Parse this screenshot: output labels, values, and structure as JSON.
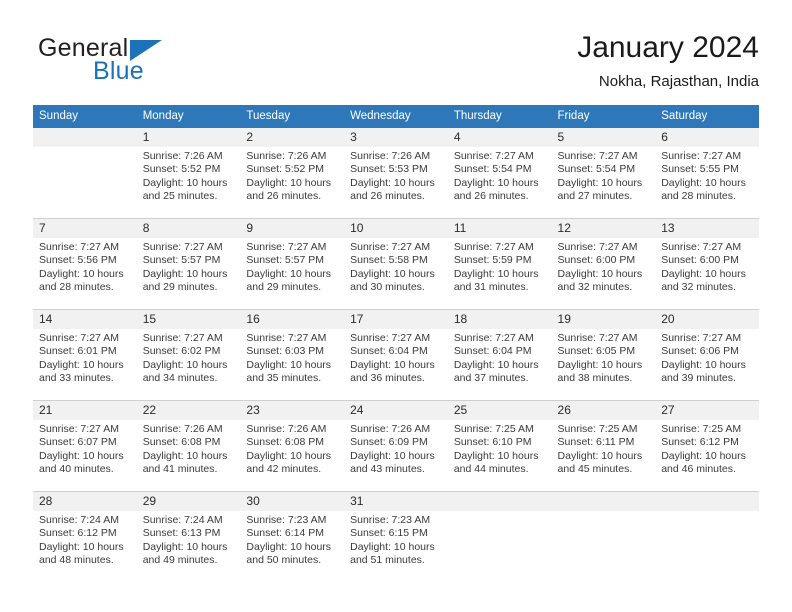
{
  "logo": {
    "word_top": "General",
    "word_bottom": "Blue",
    "brand_color": "#1b72b8"
  },
  "header": {
    "title": "January 2024",
    "subtitle": "Nokha, Rajasthan, India"
  },
  "calendar": {
    "header_color": "#2e78b9",
    "weekday_headers": [
      "Sunday",
      "Monday",
      "Tuesday",
      "Wednesday",
      "Thursday",
      "Friday",
      "Saturday"
    ],
    "weeks": [
      [
        {
          "day": "",
          "sunrise": "",
          "sunset": "",
          "daylight_line1": "",
          "daylight_line2": ""
        },
        {
          "day": "1",
          "sunrise": "Sunrise: 7:26 AM",
          "sunset": "Sunset: 5:52 PM",
          "daylight_line1": "Daylight: 10 hours",
          "daylight_line2": "and 25 minutes."
        },
        {
          "day": "2",
          "sunrise": "Sunrise: 7:26 AM",
          "sunset": "Sunset: 5:52 PM",
          "daylight_line1": "Daylight: 10 hours",
          "daylight_line2": "and 26 minutes."
        },
        {
          "day": "3",
          "sunrise": "Sunrise: 7:26 AM",
          "sunset": "Sunset: 5:53 PM",
          "daylight_line1": "Daylight: 10 hours",
          "daylight_line2": "and 26 minutes."
        },
        {
          "day": "4",
          "sunrise": "Sunrise: 7:27 AM",
          "sunset": "Sunset: 5:54 PM",
          "daylight_line1": "Daylight: 10 hours",
          "daylight_line2": "and 26 minutes."
        },
        {
          "day": "5",
          "sunrise": "Sunrise: 7:27 AM",
          "sunset": "Sunset: 5:54 PM",
          "daylight_line1": "Daylight: 10 hours",
          "daylight_line2": "and 27 minutes."
        },
        {
          "day": "6",
          "sunrise": "Sunrise: 7:27 AM",
          "sunset": "Sunset: 5:55 PM",
          "daylight_line1": "Daylight: 10 hours",
          "daylight_line2": "and 28 minutes."
        }
      ],
      [
        {
          "day": "7",
          "sunrise": "Sunrise: 7:27 AM",
          "sunset": "Sunset: 5:56 PM",
          "daylight_line1": "Daylight: 10 hours",
          "daylight_line2": "and 28 minutes."
        },
        {
          "day": "8",
          "sunrise": "Sunrise: 7:27 AM",
          "sunset": "Sunset: 5:57 PM",
          "daylight_line1": "Daylight: 10 hours",
          "daylight_line2": "and 29 minutes."
        },
        {
          "day": "9",
          "sunrise": "Sunrise: 7:27 AM",
          "sunset": "Sunset: 5:57 PM",
          "daylight_line1": "Daylight: 10 hours",
          "daylight_line2": "and 29 minutes."
        },
        {
          "day": "10",
          "sunrise": "Sunrise: 7:27 AM",
          "sunset": "Sunset: 5:58 PM",
          "daylight_line1": "Daylight: 10 hours",
          "daylight_line2": "and 30 minutes."
        },
        {
          "day": "11",
          "sunrise": "Sunrise: 7:27 AM",
          "sunset": "Sunset: 5:59 PM",
          "daylight_line1": "Daylight: 10 hours",
          "daylight_line2": "and 31 minutes."
        },
        {
          "day": "12",
          "sunrise": "Sunrise: 7:27 AM",
          "sunset": "Sunset: 6:00 PM",
          "daylight_line1": "Daylight: 10 hours",
          "daylight_line2": "and 32 minutes."
        },
        {
          "day": "13",
          "sunrise": "Sunrise: 7:27 AM",
          "sunset": "Sunset: 6:00 PM",
          "daylight_line1": "Daylight: 10 hours",
          "daylight_line2": "and 32 minutes."
        }
      ],
      [
        {
          "day": "14",
          "sunrise": "Sunrise: 7:27 AM",
          "sunset": "Sunset: 6:01 PM",
          "daylight_line1": "Daylight: 10 hours",
          "daylight_line2": "and 33 minutes."
        },
        {
          "day": "15",
          "sunrise": "Sunrise: 7:27 AM",
          "sunset": "Sunset: 6:02 PM",
          "daylight_line1": "Daylight: 10 hours",
          "daylight_line2": "and 34 minutes."
        },
        {
          "day": "16",
          "sunrise": "Sunrise: 7:27 AM",
          "sunset": "Sunset: 6:03 PM",
          "daylight_line1": "Daylight: 10 hours",
          "daylight_line2": "and 35 minutes."
        },
        {
          "day": "17",
          "sunrise": "Sunrise: 7:27 AM",
          "sunset": "Sunset: 6:04 PM",
          "daylight_line1": "Daylight: 10 hours",
          "daylight_line2": "and 36 minutes."
        },
        {
          "day": "18",
          "sunrise": "Sunrise: 7:27 AM",
          "sunset": "Sunset: 6:04 PM",
          "daylight_line1": "Daylight: 10 hours",
          "daylight_line2": "and 37 minutes."
        },
        {
          "day": "19",
          "sunrise": "Sunrise: 7:27 AM",
          "sunset": "Sunset: 6:05 PM",
          "daylight_line1": "Daylight: 10 hours",
          "daylight_line2": "and 38 minutes."
        },
        {
          "day": "20",
          "sunrise": "Sunrise: 7:27 AM",
          "sunset": "Sunset: 6:06 PM",
          "daylight_line1": "Daylight: 10 hours",
          "daylight_line2": "and 39 minutes."
        }
      ],
      [
        {
          "day": "21",
          "sunrise": "Sunrise: 7:27 AM",
          "sunset": "Sunset: 6:07 PM",
          "daylight_line1": "Daylight: 10 hours",
          "daylight_line2": "and 40 minutes."
        },
        {
          "day": "22",
          "sunrise": "Sunrise: 7:26 AM",
          "sunset": "Sunset: 6:08 PM",
          "daylight_line1": "Daylight: 10 hours",
          "daylight_line2": "and 41 minutes."
        },
        {
          "day": "23",
          "sunrise": "Sunrise: 7:26 AM",
          "sunset": "Sunset: 6:08 PM",
          "daylight_line1": "Daylight: 10 hours",
          "daylight_line2": "and 42 minutes."
        },
        {
          "day": "24",
          "sunrise": "Sunrise: 7:26 AM",
          "sunset": "Sunset: 6:09 PM",
          "daylight_line1": "Daylight: 10 hours",
          "daylight_line2": "and 43 minutes."
        },
        {
          "day": "25",
          "sunrise": "Sunrise: 7:25 AM",
          "sunset": "Sunset: 6:10 PM",
          "daylight_line1": "Daylight: 10 hours",
          "daylight_line2": "and 44 minutes."
        },
        {
          "day": "26",
          "sunrise": "Sunrise: 7:25 AM",
          "sunset": "Sunset: 6:11 PM",
          "daylight_line1": "Daylight: 10 hours",
          "daylight_line2": "and 45 minutes."
        },
        {
          "day": "27",
          "sunrise": "Sunrise: 7:25 AM",
          "sunset": "Sunset: 6:12 PM",
          "daylight_line1": "Daylight: 10 hours",
          "daylight_line2": "and 46 minutes."
        }
      ],
      [
        {
          "day": "28",
          "sunrise": "Sunrise: 7:24 AM",
          "sunset": "Sunset: 6:12 PM",
          "daylight_line1": "Daylight: 10 hours",
          "daylight_line2": "and 48 minutes."
        },
        {
          "day": "29",
          "sunrise": "Sunrise: 7:24 AM",
          "sunset": "Sunset: 6:13 PM",
          "daylight_line1": "Daylight: 10 hours",
          "daylight_line2": "and 49 minutes."
        },
        {
          "day": "30",
          "sunrise": "Sunrise: 7:23 AM",
          "sunset": "Sunset: 6:14 PM",
          "daylight_line1": "Daylight: 10 hours",
          "daylight_line2": "and 50 minutes."
        },
        {
          "day": "31",
          "sunrise": "Sunrise: 7:23 AM",
          "sunset": "Sunset: 6:15 PM",
          "daylight_line1": "Daylight: 10 hours",
          "daylight_line2": "and 51 minutes."
        },
        {
          "day": "",
          "sunrise": "",
          "sunset": "",
          "daylight_line1": "",
          "daylight_line2": ""
        },
        {
          "day": "",
          "sunrise": "",
          "sunset": "",
          "daylight_line1": "",
          "daylight_line2": ""
        },
        {
          "day": "",
          "sunrise": "",
          "sunset": "",
          "daylight_line1": "",
          "daylight_line2": ""
        }
      ]
    ]
  }
}
